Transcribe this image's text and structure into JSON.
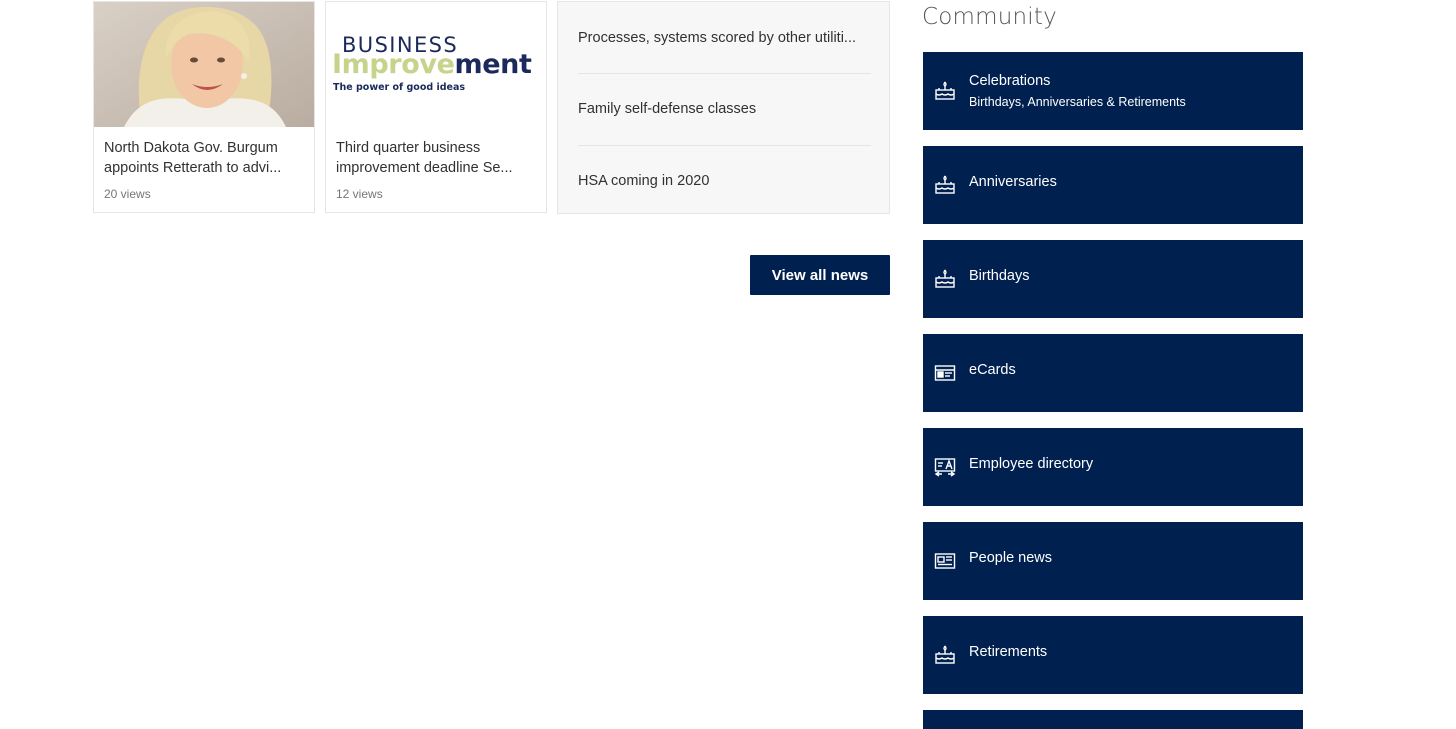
{
  "news": {
    "cards": [
      {
        "title_line1": "North Dakota Gov. Burgum",
        "title_line2": "appoints Retterath to advi...",
        "views": "20 views"
      },
      {
        "title_line1": "Third quarter business",
        "title_line2": "improvement deadline Se...",
        "views": "12 views",
        "logo": {
          "word1": "BUSINESS",
          "word2a": "Improve",
          "word2b": "ment",
          "tagline": "The power of good ideas"
        }
      }
    ],
    "headlines": [
      "Processes, systems scored by other utiliti...",
      "Family self-defense classes",
      "HSA coming in 2020"
    ],
    "view_all_label": "View all news"
  },
  "community": {
    "title": "Community",
    "tiles": [
      {
        "label": "Celebrations",
        "sub": "Birthdays, Anniversaries & Retirements",
        "icon": "cake-icon"
      },
      {
        "label": "Anniversaries",
        "icon": "cake-icon"
      },
      {
        "label": "Birthdays",
        "icon": "cake-icon"
      },
      {
        "label": "eCards",
        "icon": "ecard-icon"
      },
      {
        "label": "Employee directory",
        "icon": "directory-icon"
      },
      {
        "label": "People news",
        "icon": "newspaper-icon"
      },
      {
        "label": "Retirements",
        "icon": "cake-icon"
      }
    ]
  },
  "colors": {
    "tile_bg": "#002050",
    "logo_navy": "#1b2a5a",
    "logo_green": "#c5d48a"
  }
}
